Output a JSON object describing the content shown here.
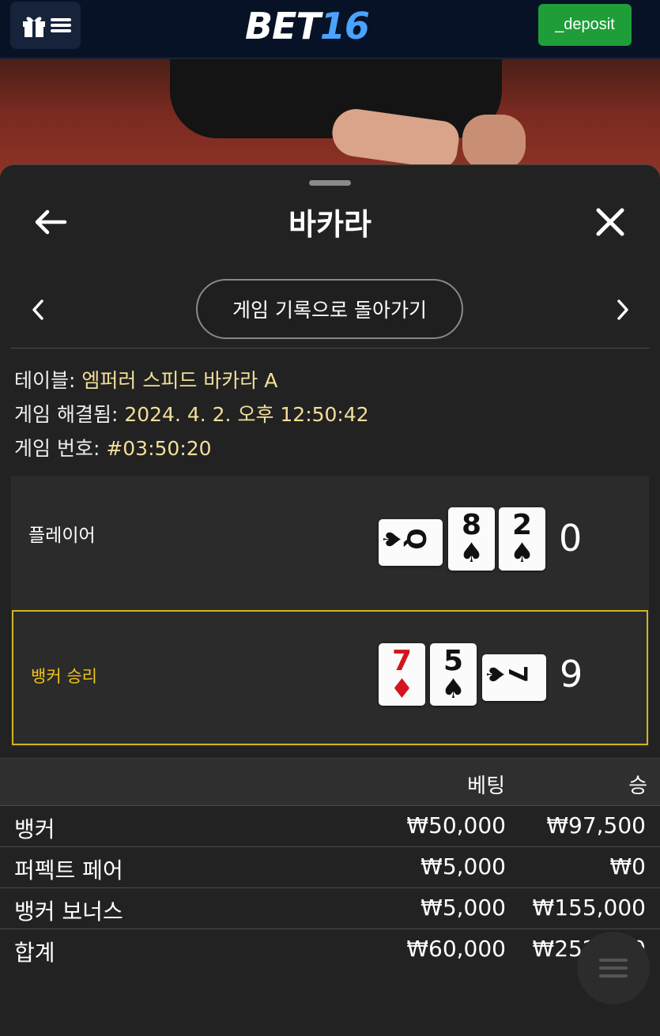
{
  "header": {
    "brand_part1": "BET",
    "brand_part2": "16",
    "deposit_label": "_deposit"
  },
  "sheet": {
    "title": "바카라",
    "history_button": "게임 기록으로 돌아가기"
  },
  "info": {
    "table_label": "테이블: ",
    "table_value": "엠퍼러 스피드 바카라 A",
    "resolved_label": "게임 해결됨: ",
    "resolved_value": "2024. 4. 2. 오후 12:50:42",
    "number_label": "게임 번호: ",
    "number_value": "#03:50:20"
  },
  "results": {
    "player": {
      "label": "플레이어",
      "score": "0",
      "cards": [
        {
          "rank": "Q",
          "suit": "♠",
          "color": "black",
          "orientation": "sideways"
        },
        {
          "rank": "8",
          "suit": "♠",
          "color": "black",
          "orientation": "upright"
        },
        {
          "rank": "2",
          "suit": "♠",
          "color": "black",
          "orientation": "upright"
        }
      ]
    },
    "banker": {
      "label": "뱅커 승리",
      "score": "9",
      "cards": [
        {
          "rank": "7",
          "suit": "♦",
          "color": "red",
          "orientation": "upright"
        },
        {
          "rank": "5",
          "suit": "♠",
          "color": "black",
          "orientation": "upright"
        },
        {
          "rank": "7",
          "suit": "♠",
          "color": "black",
          "orientation": "sideways"
        }
      ]
    }
  },
  "bets": {
    "header_bet": "베팅",
    "header_win": "승",
    "rows": [
      {
        "name": "뱅커",
        "bet": "₩50,000",
        "win": "₩97,500"
      },
      {
        "name": "퍼펙트 페어",
        "bet": "₩5,000",
        "win": "₩0"
      },
      {
        "name": "뱅커 보너스",
        "bet": "₩5,000",
        "win": "₩155,000"
      },
      {
        "name": "합계",
        "bet": "₩60,000",
        "win": "₩252,500"
      }
    ]
  },
  "colors": {
    "deposit": "#1f9d38",
    "brand_accent": "#4aa3ff",
    "win_highlight": "#d2b422",
    "info_value": "#f2df9a"
  }
}
